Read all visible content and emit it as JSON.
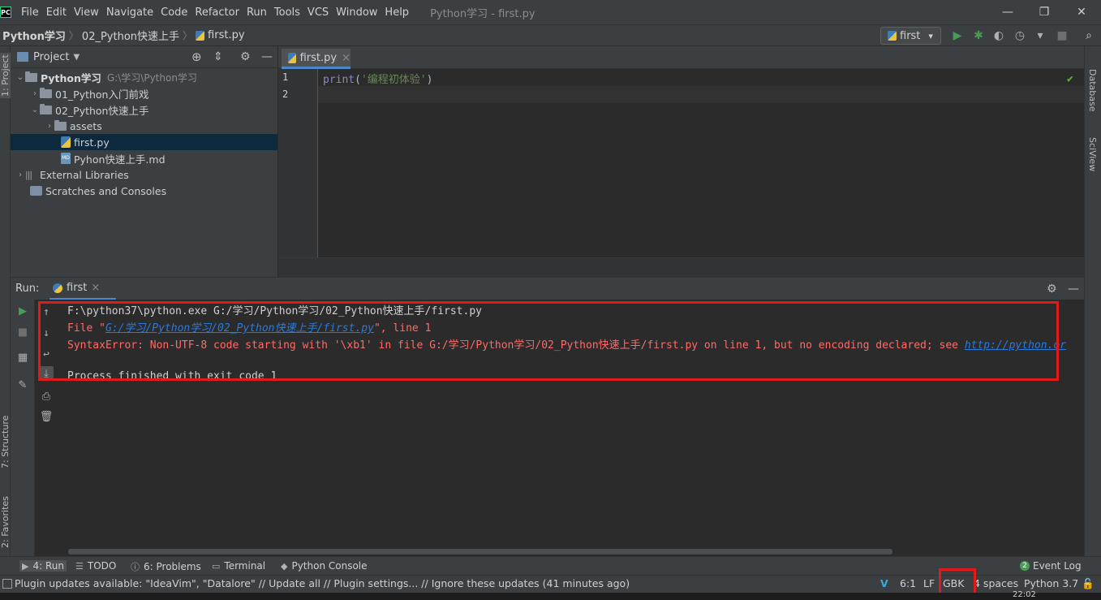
{
  "window": {
    "logo": "PC",
    "title": "Python学习 - first.py",
    "minimize": "—",
    "maximize": "❐",
    "close": "✕"
  },
  "menu": [
    "File",
    "Edit",
    "View",
    "Navigate",
    "Code",
    "Refactor",
    "Run",
    "Tools",
    "VCS",
    "Window",
    "Help"
  ],
  "breadcrumb": [
    "Python学习",
    "02_Python快速上手",
    "first.py"
  ],
  "run_config": {
    "label": "first",
    "dropdown": "▾"
  },
  "side_tabs": {
    "left": [
      "1: Project",
      "7: Structure",
      "2: Favorites"
    ],
    "right": [
      "Database",
      "SciView"
    ]
  },
  "project_panel": {
    "title": "Project",
    "tree": [
      {
        "label": "Python学习",
        "hint": "G:\\学习\\Python学习",
        "type": "folder",
        "expanded": true,
        "depth": 0
      },
      {
        "label": "01_Python入门前戏",
        "type": "folder",
        "expanded": false,
        "depth": 1
      },
      {
        "label": "02_Python快速上手",
        "type": "folder",
        "expanded": true,
        "depth": 1
      },
      {
        "label": "assets",
        "type": "folder",
        "expanded": false,
        "depth": 2
      },
      {
        "label": "first.py",
        "type": "python",
        "selected": true,
        "depth": 2
      },
      {
        "label": "Pyhon快速上手.md",
        "type": "markdown",
        "depth": 2
      },
      {
        "label": "External Libraries",
        "type": "library",
        "expanded": false,
        "depth": 0
      },
      {
        "label": "Scratches and Consoles",
        "type": "scratch",
        "depth": 0
      }
    ]
  },
  "editor": {
    "tab": "first.py",
    "tab_close": "×",
    "line_numbers": [
      "1",
      "2"
    ],
    "code": {
      "func": "print",
      "open": "(",
      "string": "'编程初体验'",
      "close": ")"
    },
    "inspection_ok": "✔"
  },
  "run_panel": {
    "label": "Run:",
    "tab": "first",
    "tab_close": "×",
    "console": {
      "line1": "F:\\python37\\python.exe G:/学习/Python学习/02_Python快速上手/first.py",
      "line2_prefix": "  File \"",
      "line2_link": "G:/学习/Python学习/02_Python快速上手/first.py",
      "line2_suffix": "\", line 1",
      "line3_text": "SyntaxError: Non-UTF-8 code starting with '\\xb1' in file G:/学习/Python学习/02_Python快速上手/first.py on line 1, but no encoding declared; see ",
      "line3_link": "http://python.or",
      "line5": "Process finished with exit code 1"
    }
  },
  "bottom_tabs": [
    {
      "icon": "▶",
      "label": "4: Run"
    },
    {
      "icon": "☰",
      "label": "TODO"
    },
    {
      "icon": "ⓘ",
      "label": "6: Problems"
    },
    {
      "icon": "▭",
      "label": "Terminal"
    },
    {
      "icon": "◆",
      "label": "Python Console"
    }
  ],
  "event_log": {
    "badge": "2",
    "label": "Event Log"
  },
  "status": {
    "message": "Plugin updates available: \"IdeaVim\", \"Datalore\" // Update all // Plugin settings... // Ignore these updates (41 minutes ago)",
    "position": "6:1",
    "line_sep": "LF",
    "encoding": "GBK",
    "indent": "4 spaces",
    "interpreter": "Python 3.7",
    "clock": "22:02"
  },
  "colors": {
    "accent": "#4a88c7",
    "annotation": "#e11a1a",
    "error_text": "#ff6b68",
    "run_green": "#499c54"
  }
}
